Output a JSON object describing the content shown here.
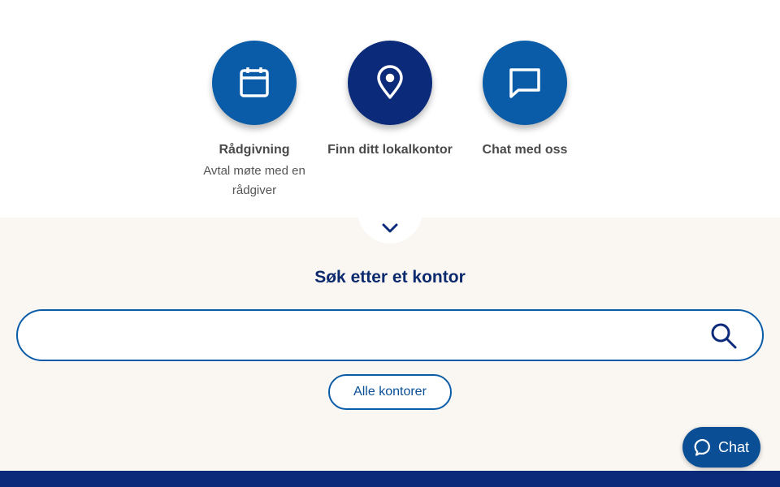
{
  "actions": [
    {
      "title": "Rådgivning",
      "subtitle": "Avtal møte med en rådgiver",
      "icon": "calendar-icon",
      "color": "#0a5ca8"
    },
    {
      "title": "Finn ditt lokalkontor",
      "subtitle": "",
      "icon": "map-pin-icon",
      "color": "#0b2a7a"
    },
    {
      "title": "Chat med oss",
      "subtitle": "",
      "icon": "chat-bubble-icon",
      "color": "#0a5ca8"
    }
  ],
  "expand_icon": "chevron-down-icon",
  "search": {
    "title": "Søk etter et kontor",
    "value": "",
    "placeholder": "",
    "icon": "search-icon"
  },
  "all_offices_label": "Alle kontorer",
  "chat_widget": {
    "label": "Chat",
    "icon": "chat-bubble-icon"
  },
  "colors": {
    "primary": "#0a5ca8",
    "dark_navy": "#0b2a7a",
    "title_navy": "#0b2a6e",
    "background_band": "#faf6f2"
  }
}
